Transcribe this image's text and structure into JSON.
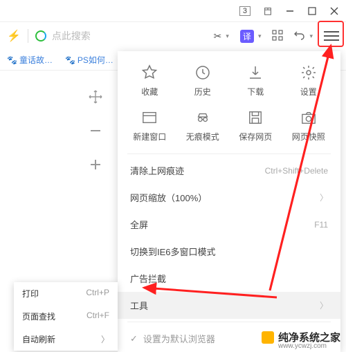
{
  "titlebar": {
    "badge": "3"
  },
  "toolbar": {
    "search_placeholder": "点此搜索",
    "translate_badge": "译"
  },
  "bookmarks": [
    {
      "label": "童话故…"
    },
    {
      "label": "PS如何…"
    }
  ],
  "menu": {
    "row1": [
      {
        "label": "收藏",
        "icon": "star"
      },
      {
        "label": "历史",
        "icon": "clock"
      },
      {
        "label": "下载",
        "icon": "download"
      },
      {
        "label": "设置",
        "icon": "gear"
      }
    ],
    "row2": [
      {
        "label": "新建窗口",
        "icon": "window"
      },
      {
        "label": "无痕模式",
        "icon": "incognito"
      },
      {
        "label": "保存网页",
        "icon": "save"
      },
      {
        "label": "网页快照",
        "icon": "camera"
      }
    ],
    "list": [
      {
        "label": "清除上网痕迹",
        "hint": "Ctrl+Shift+Delete"
      },
      {
        "label": "网页缩放（100%）",
        "chevron": true
      },
      {
        "label": "全屏",
        "hint": "F11"
      },
      {
        "label": "切换到IE6多窗口模式"
      },
      {
        "label": "广告拦截"
      },
      {
        "label": "工具",
        "chevron": true,
        "hover": true
      }
    ],
    "default_browser": "设置为默认浏览器"
  },
  "context": {
    "items": [
      {
        "label": "打印",
        "hint": "Ctrl+P"
      },
      {
        "label": "页面查找",
        "hint": "Ctrl+F"
      },
      {
        "label": "自动刷新",
        "chevron": true
      }
    ]
  },
  "watermark": {
    "text": "纯净系统之家",
    "url": "www.ycwzj.com"
  }
}
